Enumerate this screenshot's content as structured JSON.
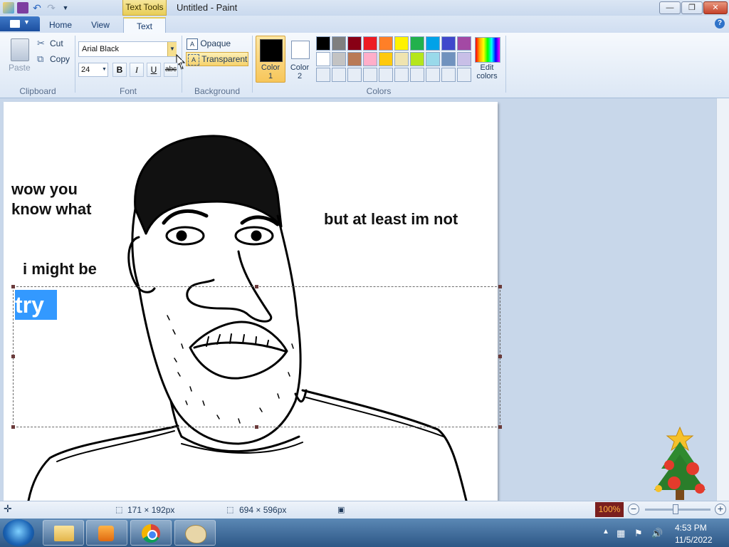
{
  "window": {
    "title": "Untitled - Paint",
    "context_tab": "Text Tools",
    "controls": {
      "minimize": "—",
      "maximize": "❐",
      "close": "✕"
    }
  },
  "tabs": {
    "home": "Home",
    "view": "View",
    "text": "Text"
  },
  "help_icon": "?",
  "clipboard": {
    "paste": "Paste",
    "cut": "Cut",
    "copy": "Copy",
    "group": "Clipboard"
  },
  "font": {
    "family": "Arial Black",
    "size": "24",
    "bold": "B",
    "italic": "I",
    "underline": "U",
    "strike": "abc",
    "group": "Font"
  },
  "background": {
    "opaque": "Opaque",
    "transparent": "Transparent",
    "group": "Background"
  },
  "colors": {
    "color1_label": "Color\n1",
    "color2_label": "Color\n2",
    "edit_label": "Edit\ncolors",
    "group": "Colors",
    "color1": "#000000",
    "color2": "#ffffff",
    "palette": [
      "#000000",
      "#7f7f7f",
      "#880015",
      "#ed1c24",
      "#ff7f27",
      "#fff200",
      "#22b14c",
      "#00a2e8",
      "#3f48cc",
      "#a349a4",
      "#ffffff",
      "#c3c3c3",
      "#b97a57",
      "#ffaec9",
      "#ffc90e",
      "#efe4b0",
      "#b5e61d",
      "#99d9ea",
      "#7092be",
      "#c8bfe7",
      "#e6edf6",
      "#e6edf6",
      "#e6edf6",
      "#e6edf6",
      "#e6edf6",
      "#e6edf6",
      "#e6edf6",
      "#e6edf6",
      "#e6edf6",
      "#e6edf6"
    ]
  },
  "canvas": {
    "text1_line1": "wow you",
    "text1_line2": "know what",
    "text2": "but at least im not",
    "text3": "i might be",
    "editing_text": "try"
  },
  "status": {
    "selection_size": "171 × 192px",
    "canvas_size": "694 × 596px",
    "zoom": "100%",
    "zoom_out": "−",
    "zoom_in": "+"
  },
  "taskbar": {
    "time": "4:53 PM",
    "date": "11/5/2022"
  }
}
